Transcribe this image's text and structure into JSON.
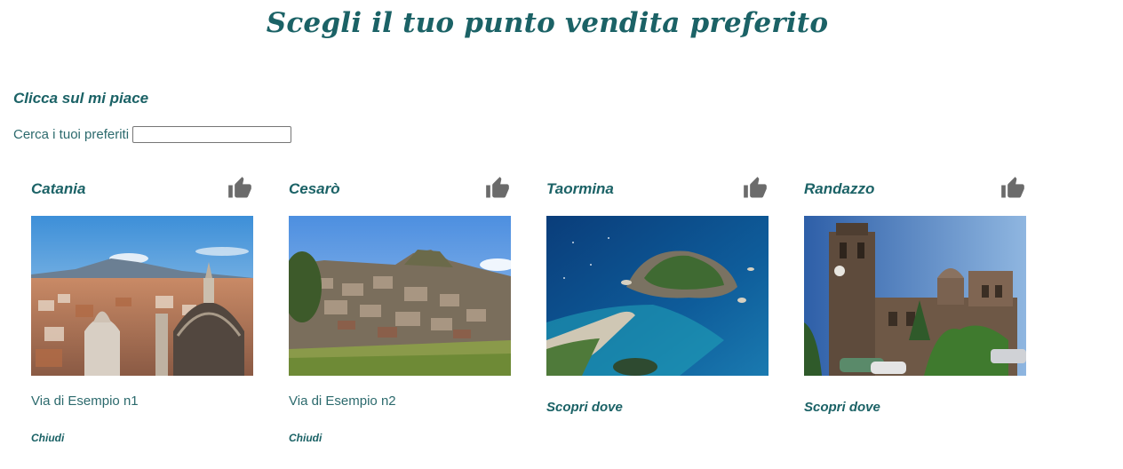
{
  "header": {
    "title": "Scegli il tuo punto vendita preferito"
  },
  "intro": {
    "subtitle": "Clicca sul mi piace",
    "search_label": "Cerca i tuoi preferiti",
    "search_value": ""
  },
  "colors": {
    "accent": "#1b6266",
    "text": "#2c6a6d",
    "like_icon": "#6b6b6b"
  },
  "stores": [
    {
      "name": "Catania",
      "like_icon": "thumbs-up-icon",
      "address": "Via di Esempio n1",
      "close_label": "Chiudi",
      "image": "catania-city-photo"
    },
    {
      "name": "Cesarò",
      "like_icon": "thumbs-up-icon",
      "address": "Via di Esempio n2",
      "close_label": "Chiudi",
      "image": "cesaro-village-photo"
    },
    {
      "name": "Taormina",
      "like_icon": "thumbs-up-icon",
      "discover_label": "Scopri dove",
      "image": "taormina-isola-bella-photo"
    },
    {
      "name": "Randazzo",
      "like_icon": "thumbs-up-icon",
      "discover_label": "Scopri dove",
      "image": "randazzo-cathedral-photo"
    }
  ]
}
